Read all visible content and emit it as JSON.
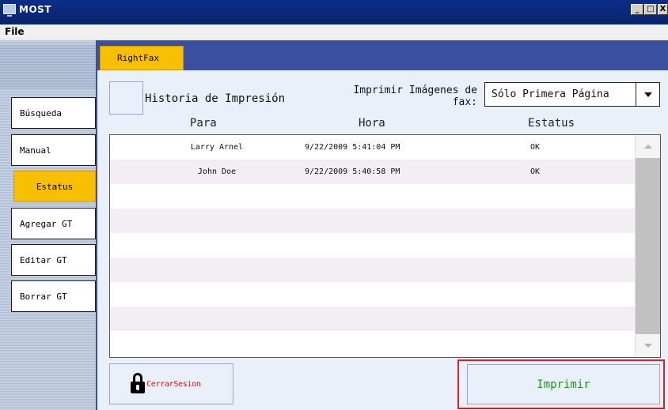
{
  "window": {
    "title": "MOST",
    "minimize_label": "_",
    "maximize_label": "□",
    "close_label": "X"
  },
  "menu": {
    "file": "File"
  },
  "nav": {
    "items": [
      {
        "label": "Búsqueda",
        "active": false
      },
      {
        "label": "Manual",
        "active": false
      },
      {
        "label": "Estatus",
        "active": true
      },
      {
        "label": "Agregar GT",
        "active": false
      },
      {
        "label": "Editar GT",
        "active": false
      },
      {
        "label": "Borrar GT",
        "active": false
      }
    ]
  },
  "tabs": {
    "active": "RightFax"
  },
  "history": {
    "label": "Historia de Impresión"
  },
  "print_images": {
    "label_line1": "Imprimir Imágenes de",
    "label_line2": "fax:",
    "selected": "Sólo Primera Página"
  },
  "table": {
    "headers": {
      "para": "Para",
      "hora": "Hora",
      "estatus": "Estatus"
    },
    "rows": [
      {
        "para": "Larry Arnel",
        "hora": "9/22/2009 5:41:04 PM",
        "estatus": "OK"
      },
      {
        "para": "John Doe",
        "hora": "9/22/2009 5:40:58 PM",
        "estatus": "OK"
      }
    ]
  },
  "actions": {
    "logout": "CerrarSesion",
    "print": "Imprimir"
  },
  "colors": {
    "title_bar": "#0a246a",
    "tab_strip": "#3c4ea0",
    "active_accent": "#f8bf00",
    "print_text": "#1a9b1a",
    "logout_text": "#d21c1c",
    "highlight_border": "#e01f24"
  }
}
